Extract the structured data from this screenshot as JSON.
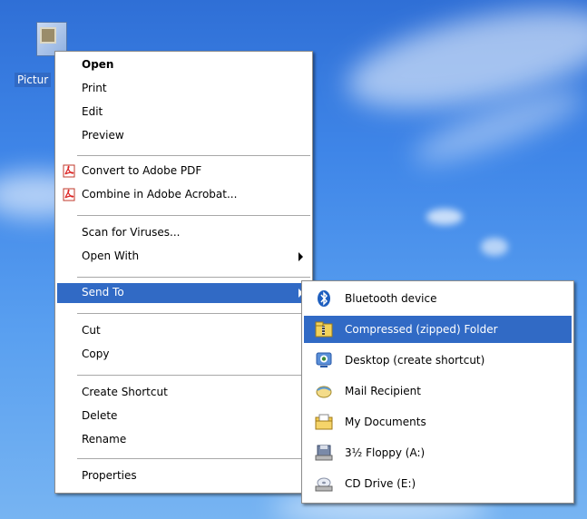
{
  "desktop": {
    "file_label": "Pictur"
  },
  "context_menu": {
    "items": [
      {
        "label": "Open"
      },
      {
        "label": "Print"
      },
      {
        "label": "Edit"
      },
      {
        "label": "Preview"
      },
      {
        "label": "Convert to Adobe PDF",
        "icon": "adobe-pdf-icon"
      },
      {
        "label": "Combine in Adobe Acrobat...",
        "icon": "adobe-pdf-icon"
      },
      {
        "label": "Scan for Viruses..."
      },
      {
        "label": "Open With"
      },
      {
        "label": "Send To"
      },
      {
        "label": "Cut"
      },
      {
        "label": "Copy"
      },
      {
        "label": "Create Shortcut"
      },
      {
        "label": "Delete"
      },
      {
        "label": "Rename"
      },
      {
        "label": "Properties"
      }
    ],
    "highlighted": "Send To"
  },
  "send_to_menu": {
    "items": [
      {
        "label": "Bluetooth device",
        "icon": "bluetooth-icon"
      },
      {
        "label": "Compressed (zipped) Folder",
        "icon": "zip-folder-icon"
      },
      {
        "label": "Desktop (create shortcut)",
        "icon": "desktop-icon"
      },
      {
        "label": "Mail Recipient",
        "icon": "mail-icon"
      },
      {
        "label": "My Documents",
        "icon": "my-documents-icon"
      },
      {
        "label": "3½ Floppy (A:)",
        "icon": "floppy-drive-icon"
      },
      {
        "label": "CD Drive (E:)",
        "icon": "cd-drive-icon"
      }
    ],
    "highlighted": "Compressed (zipped) Folder"
  },
  "colors": {
    "highlight": "#316ac5",
    "menu_bg": "#ffffff",
    "desktop_sky": "#3f86e8"
  }
}
